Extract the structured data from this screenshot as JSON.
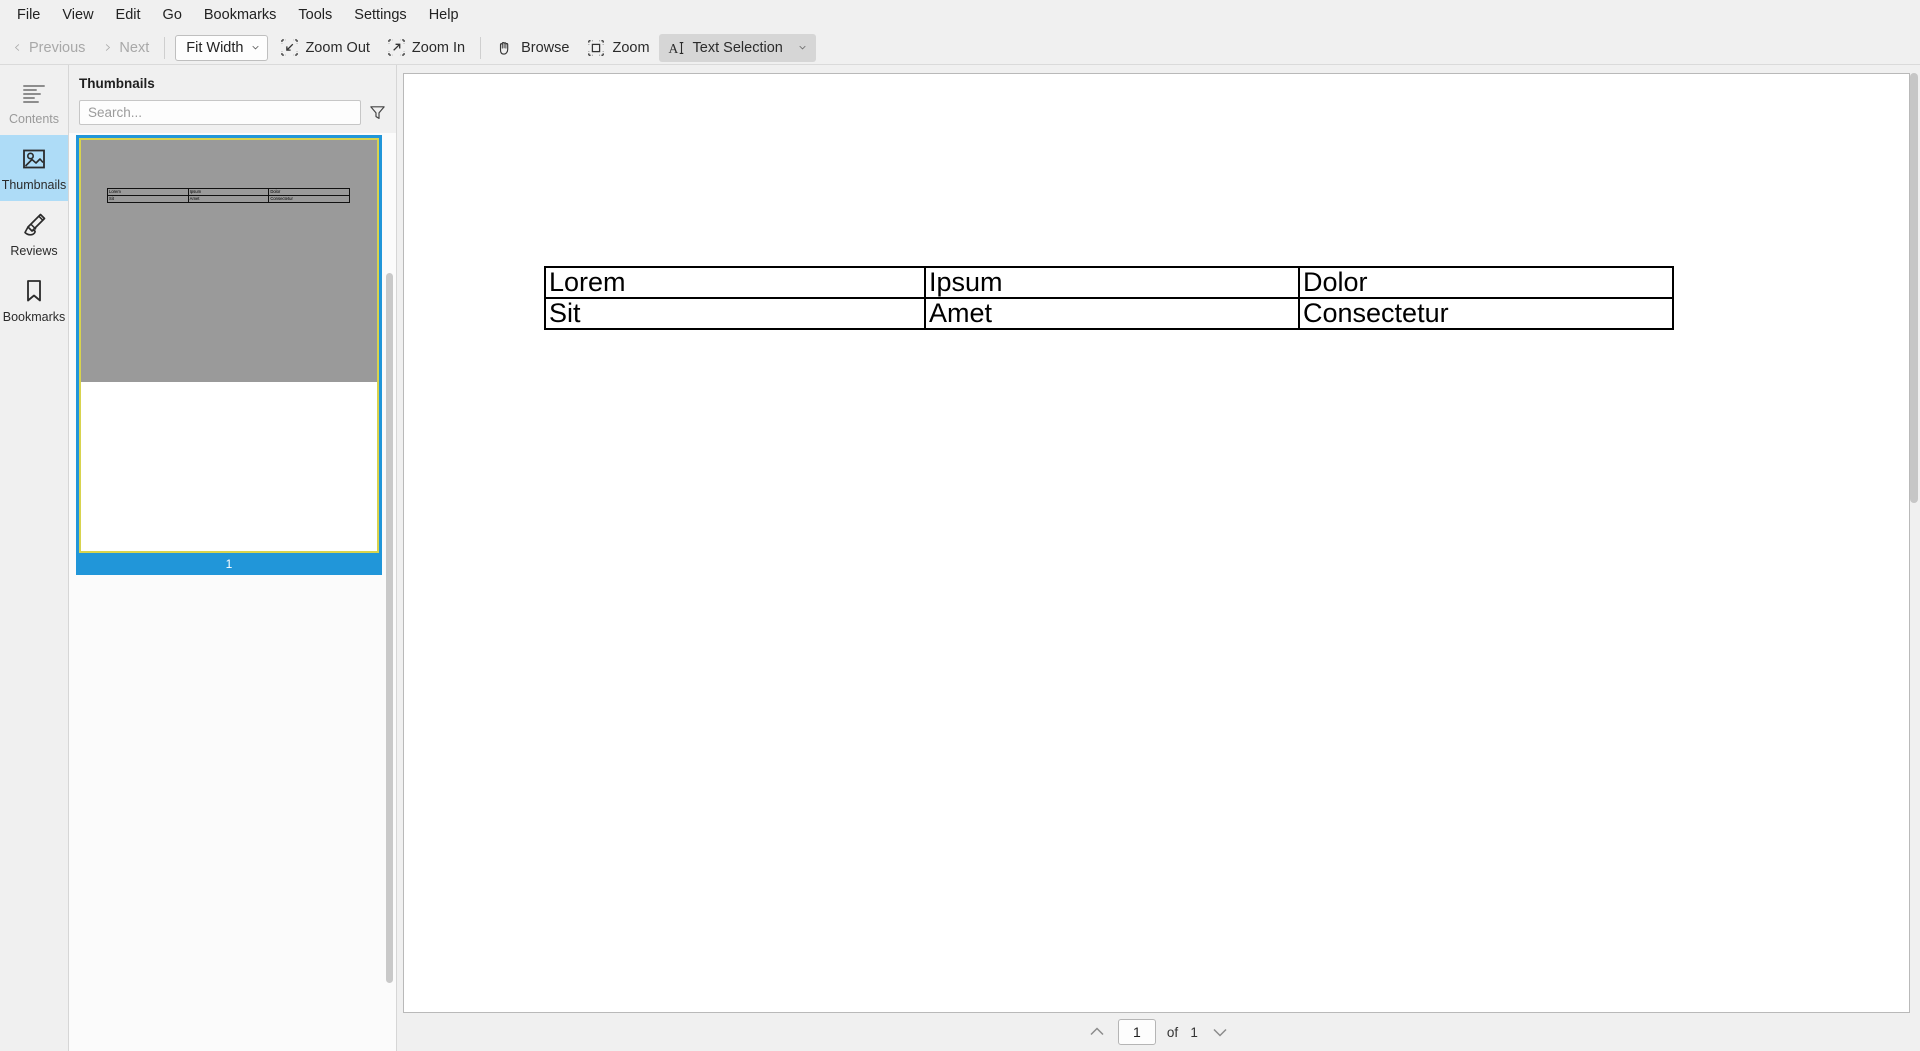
{
  "menubar": {
    "items": [
      {
        "label": "File"
      },
      {
        "label": "View"
      },
      {
        "label": "Edit"
      },
      {
        "label": "Go"
      },
      {
        "label": "Bookmarks"
      },
      {
        "label": "Tools"
      },
      {
        "label": "Settings"
      },
      {
        "label": "Help"
      }
    ]
  },
  "toolbar": {
    "previous_label": "Previous",
    "next_label": "Next",
    "fit_mode": "Fit Width",
    "zoom_out_label": "Zoom Out",
    "zoom_in_label": "Zoom In",
    "browse_label": "Browse",
    "zoom_label": "Zoom",
    "text_selection_label": "Text Selection"
  },
  "rail": {
    "items": [
      {
        "label": "Contents",
        "icon": "list-lines-icon",
        "selected": false,
        "dim": true
      },
      {
        "label": "Thumbnails",
        "icon": "image-icon",
        "selected": true,
        "dim": false
      },
      {
        "label": "Reviews",
        "icon": "highlighter-pen-icon",
        "selected": false,
        "dim": false
      },
      {
        "label": "Bookmarks",
        "icon": "bookmark-ribbon-icon",
        "selected": false,
        "dim": false
      }
    ]
  },
  "thumbnails_panel": {
    "title": "Thumbnails",
    "search_placeholder": "Search...",
    "search_value": "",
    "filter_icon": "filter-funnel-icon",
    "pages": [
      {
        "number": "1",
        "selected": true
      }
    ]
  },
  "document": {
    "table": {
      "rows": [
        [
          "Lorem",
          "Ipsum",
          "Dolor"
        ],
        [
          "Sit",
          "Amet",
          "Consectetur"
        ]
      ]
    }
  },
  "pagenav": {
    "up_icon": "chevron-up-icon",
    "down_icon": "chevron-down-icon",
    "current_page": "1",
    "of_label": "of",
    "total_pages": "1"
  },
  "colors": {
    "selection_blue": "#aedcf7",
    "thumb_border_blue": "#2196d9",
    "thumb_page_border": "#d8d34e",
    "chrome_gray": "#f0f0f0"
  }
}
